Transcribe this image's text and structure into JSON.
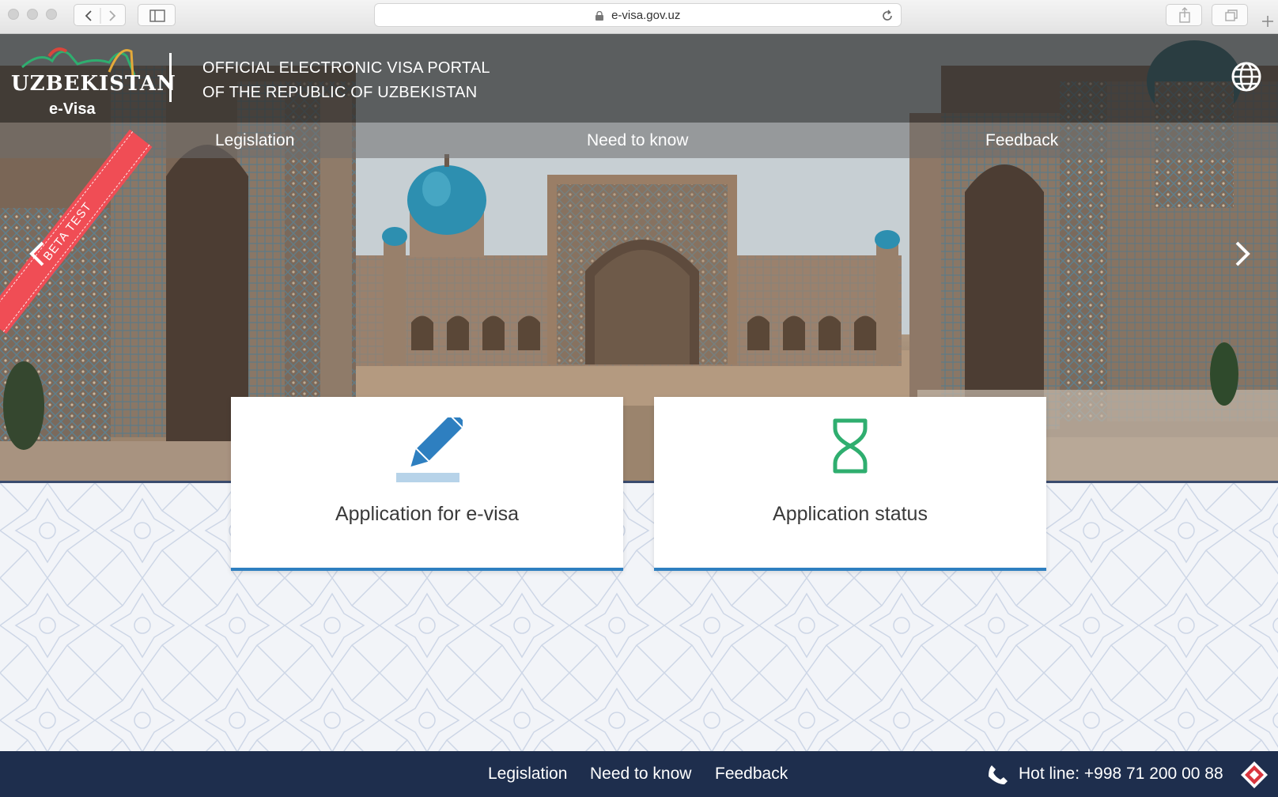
{
  "browser": {
    "url": "e-visa.gov.uz"
  },
  "header": {
    "logo_word": "UZBEKISTAN",
    "logo_sub": "e-Visa",
    "title_line1": "OFFICIAL ELECTRONIC VISA PORTAL",
    "title_line2": "OF THE REPUBLIC OF UZBEKISTAN",
    "language_icon": "globe-icon"
  },
  "nav": {
    "items": [
      {
        "label": "Legislation"
      },
      {
        "label": "Need to know"
      },
      {
        "label": "Feedback"
      }
    ]
  },
  "hero": {
    "badge": "BETA TEST",
    "prev_icon": "chevron-left-icon",
    "next_icon": "chevron-right-icon"
  },
  "cards": [
    {
      "label": "Application for e-visa",
      "icon": "pencil-icon",
      "icon_color": "#2e7fc0"
    },
    {
      "label": "Application status",
      "icon": "hourglass-icon",
      "icon_color": "#2fae6f"
    }
  ],
  "footer": {
    "links": [
      {
        "label": "Legislation"
      },
      {
        "label": "Need to know"
      },
      {
        "label": "Feedback"
      }
    ],
    "hotline": "Hot line: +998 71 200 00 88"
  },
  "colors": {
    "footer_bg": "#1e2e4d",
    "accent": "#2e7fc0",
    "badge": "#f04d55",
    "status_icon": "#2fae6f"
  }
}
